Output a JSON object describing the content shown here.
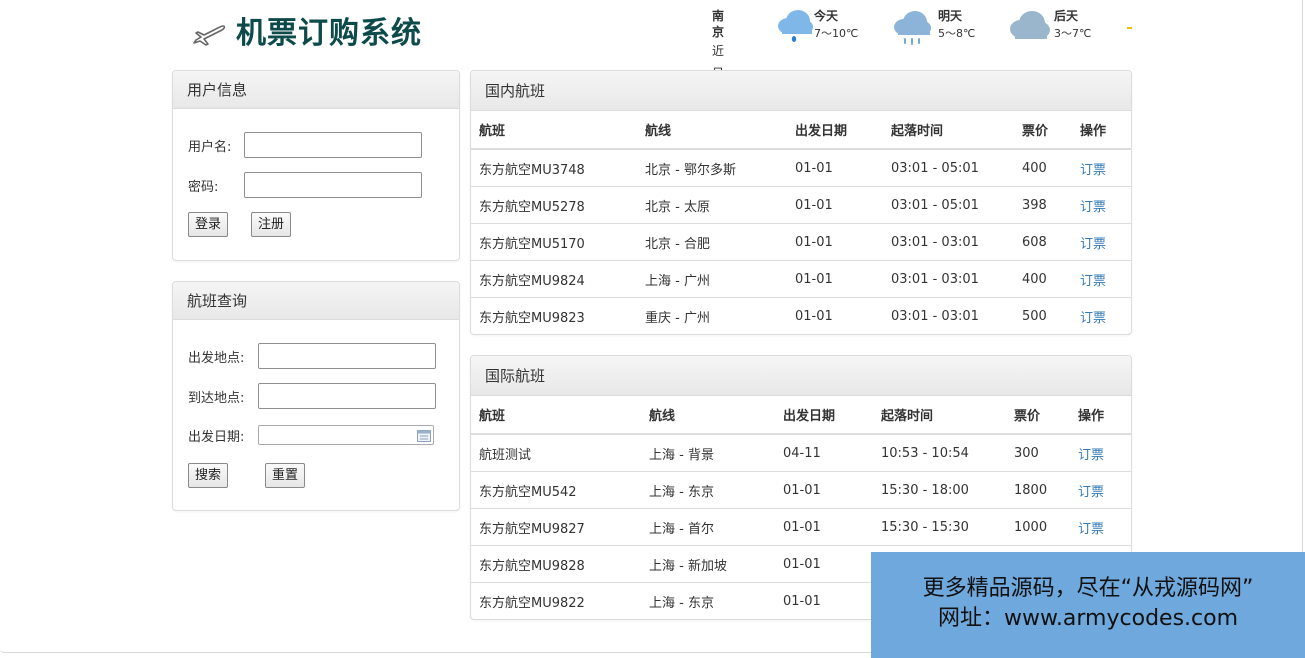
{
  "header": {
    "logo_text": "机票订购系统",
    "plane_icon": "airplane-icon"
  },
  "weather": {
    "city": "南京",
    "subtitle": "近日天气",
    "days": [
      {
        "label": "今天",
        "temp": "7～10℃",
        "icon": "cloud-rain-icon",
        "color": "#7fb8e8"
      },
      {
        "label": "明天",
        "temp": "5～8℃",
        "icon": "cloud-heavy-rain-icon",
        "color": "#8cb4d8"
      },
      {
        "label": "后天",
        "temp": "3～7℃",
        "icon": "cloud-icon",
        "color": "#9ab6cc"
      }
    ]
  },
  "user_panel": {
    "title": "用户信息",
    "username_label": "用户名:",
    "password_label": "密码:",
    "username_value": "",
    "password_value": "",
    "login_label": "登录",
    "register_label": "注册"
  },
  "search_panel": {
    "title": "航班查询",
    "from_label": "出发地点:",
    "to_label": "到达地点:",
    "date_label": "出发日期:",
    "from_value": "",
    "to_value": "",
    "date_value": "",
    "search_label": "搜索",
    "reset_label": "重置"
  },
  "domestic": {
    "title": "国内航班",
    "columns": [
      "航班",
      "航线",
      "出发日期",
      "起落时间",
      "票价",
      "操作"
    ],
    "rows": [
      {
        "flight": "东方航空MU3748",
        "route": "北京 - 鄂尔多斯",
        "date": "01-01",
        "time": "03:01 - 05:01",
        "price": "400",
        "action": "订票"
      },
      {
        "flight": "东方航空MU5278",
        "route": "北京 - 太原",
        "date": "01-01",
        "time": "03:01 - 05:01",
        "price": "398",
        "action": "订票"
      },
      {
        "flight": "东方航空MU5170",
        "route": "北京 - 合肥",
        "date": "01-01",
        "time": "03:01 - 03:01",
        "price": "608",
        "action": "订票"
      },
      {
        "flight": "东方航空MU9824",
        "route": "上海 - 广州",
        "date": "01-01",
        "time": "03:01 - 03:01",
        "price": "400",
        "action": "订票"
      },
      {
        "flight": "东方航空MU9823",
        "route": "重庆 - 广州",
        "date": "01-01",
        "time": "03:01 - 03:01",
        "price": "500",
        "action": "订票"
      }
    ]
  },
  "international": {
    "title": "国际航班",
    "columns": [
      "航班",
      "航线",
      "出发日期",
      "起落时间",
      "票价",
      "操作"
    ],
    "rows": [
      {
        "flight": "航班测试",
        "route": "上海 - 背景",
        "date": "04-11",
        "time": "10:53 - 10:54",
        "price": "300",
        "action": "订票"
      },
      {
        "flight": "东方航空MU542",
        "route": "上海 - 东京",
        "date": "01-01",
        "time": "15:30 - 18:00",
        "price": "1800",
        "action": "订票"
      },
      {
        "flight": "东方航空MU9827",
        "route": "上海 - 首尔",
        "date": "01-01",
        "time": "15:30 - 15:30",
        "price": "1000",
        "action": "订票"
      },
      {
        "flight": "东方航空MU9828",
        "route": "上海 - 新加坡",
        "date": "01-01",
        "time": "",
        "price": "",
        "action": ""
      },
      {
        "flight": "东方航空MU9822",
        "route": "上海 - 东京",
        "date": "01-01",
        "time": "",
        "price": "",
        "action": ""
      }
    ]
  },
  "watermark": {
    "line1": "更多精品源码，尽在“从戎源码网”",
    "line2": "网址：www.armycodes.com",
    "color": "#6fa8dc"
  }
}
